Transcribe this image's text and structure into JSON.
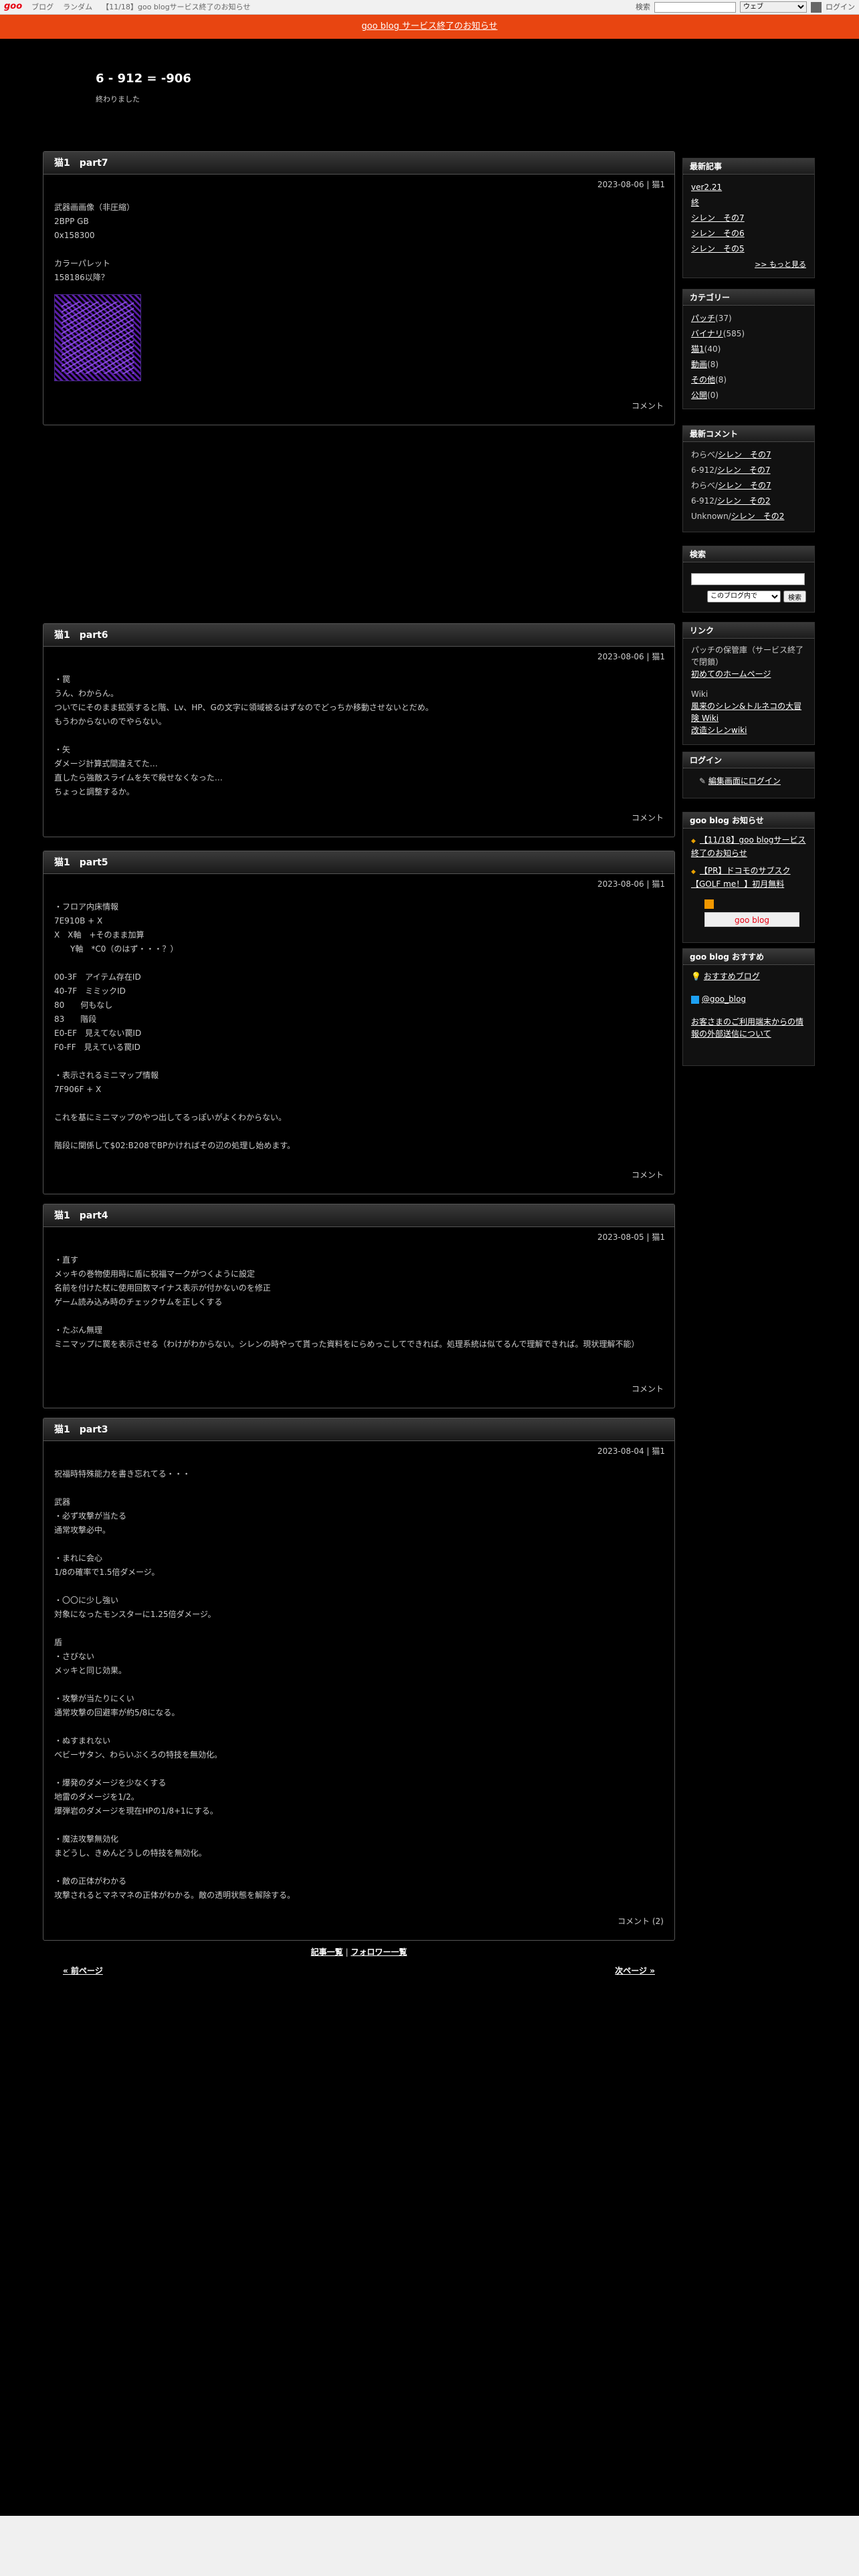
{
  "goo_bar": {
    "logo": "goo",
    "links": [
      "ブログ",
      "ランダム",
      "【11/18】goo blogサービス終了のお知らせ"
    ],
    "search_label": "検索",
    "search_select": "ウェブ",
    "login": "ログイン"
  },
  "notice": "goo blog サービス終了のお知らせ",
  "blog": {
    "title": "6 - 912 = -906",
    "description": "終わりました"
  },
  "entries": [
    {
      "title": "猫1　part7",
      "date": "2023-08-06 | 猫1",
      "lines": [
        "武器画画像（非圧縮）",
        "2BPP GB",
        "0x158300",
        "",
        "カラーパレット",
        "158186以降？"
      ],
      "comment": "コメント"
    },
    {
      "title": "猫1　part6",
      "date": "2023-08-06 | 猫1",
      "lines": [
        "・罠",
        "うん、わからん。",
        "ついでにそのまま拡張すると階、Lv、HP、Gの文字に領域被るはずなのでどっちか移動させないとだめ。",
        "もうわからないのでやらない。",
        "",
        "・矢",
        "ダメージ計算式間違えてた…",
        "直したら強敵スライムを矢で殺せなくなった…",
        "ちょっと調整するか。"
      ],
      "comment": "コメント"
    },
    {
      "title": "猫1　part5",
      "date": "2023-08-06 | 猫1",
      "lines": [
        "・フロア内床情報",
        "7E910B + X",
        "X　X軸　+そのまま加算",
        "　　Y軸　*C0（のはず・・・？）",
        "",
        "00-3F　アイテム存在ID",
        "40-7F　ミミックID",
        "80　　何もなし",
        "83　　階段",
        "E0-EF　見えてない罠ID",
        "F0-FF　見えている罠ID",
        "",
        "・表示されるミニマップ情報",
        "7F906F + X",
        "",
        "これを基にミニマップのやつ出してるっぽいがよくわからない。",
        "",
        "階段に関係して$02:B208でBPかければその辺の処理し始めます。"
      ],
      "comment": "コメント"
    },
    {
      "title": "猫1　part4",
      "date": "2023-08-05 | 猫1",
      "lines": [
        "・直す",
        "メッキの巻物使用時に盾に祝福マークがつくように設定",
        "名前を付けた杖に使用回数マイナス表示が付かないのを修正",
        "ゲーム読み込み時のチェックサムを正しくする",
        "",
        "・たぶん無理",
        "ミニマップに罠を表示させる（わけがわからない。シレンの時やって貰った資料をにらめっこしてできれば。処理系統は似てるんで理解できれば。現状理解不能）"
      ],
      "comment": "コメント"
    },
    {
      "title": "猫1　part3",
      "date": "2023-08-04 | 猫1",
      "lines": [
        "祝福時特殊能力を書き忘れてる・・・",
        "",
        "武器",
        "・必ず攻撃が当たる",
        "通常攻撃必中。",
        "",
        "・まれに会心",
        "1/8の確率で1.5倍ダメージ。",
        "",
        "・〇〇に少し強い",
        "対象になったモンスターに1.25倍ダメージ。",
        "",
        "盾",
        "・さびない",
        "メッキと同じ効果。",
        "",
        "・攻撃が当たりにくい",
        "通常攻撃の回避率が約5/8になる。",
        "",
        "・ぬすまれない",
        "ベビーサタン、わらいぶくろの特技を無効化。",
        "",
        "・爆発のダメージを少なくする",
        "地雷のダメージを1/2。",
        "爆弾岩のダメージを現在HPの1/8+1にする。",
        "",
        "・魔法攻撃無効化",
        "まどうし、きめんどうしの特技を無効化。",
        "",
        "・敵の正体がわかる",
        "攻撃されるとマネマネの正体がわかる。敵の透明状態を解除する。"
      ],
      "comment": "コメント (2)"
    }
  ],
  "sidebar": {
    "recent_entries": {
      "title": "最新記事",
      "items": [
        "ver2.21",
        "終",
        "シレン　その7",
        "シレン　その6",
        "シレン　その5"
      ],
      "more": ">> もっと見る"
    },
    "categories": {
      "title": "カテゴリー",
      "items": [
        {
          "name": "パッチ",
          "count": "(37)"
        },
        {
          "name": "バイナリ",
          "count": "(585)"
        },
        {
          "name": "猫1",
          "count": "(40)"
        },
        {
          "name": "動画",
          "count": "(8)"
        },
        {
          "name": "その他",
          "count": "(8)"
        },
        {
          "name": "公開",
          "count": "(0)"
        }
      ]
    },
    "recent_comments": {
      "title": "最新コメント",
      "items": [
        {
          "who": "わらべ/",
          "entry": "シレン　その7"
        },
        {
          "who": "6-912/",
          "entry": "シレン　その7"
        },
        {
          "who": "わらべ/",
          "entry": "シレン　その7"
        },
        {
          "who": "6-912/",
          "entry": "シレン　その2"
        },
        {
          "who": "Unknown/",
          "entry": "シレン　その2"
        }
      ]
    },
    "search": {
      "title": "検索",
      "select": "このブログ内で",
      "button": "検索"
    },
    "links": {
      "title": "リンク",
      "text1": "パッチの保管庫（サービス終了で閉鎖）",
      "link1": "初めてのホームページ",
      "text2": "Wiki",
      "link2": "風来のシレン&トルネコの大冒険 Wiki",
      "link3": "改造シレンwiki"
    },
    "login": {
      "title": "ログイン",
      "link": "編集画面にログイン"
    },
    "goo_notice": {
      "title": "goo blog お知らせ",
      "items": [
        "【11/18】goo blogサービス終了のお知らせ",
        "【PR】ドコモのサブスク【GOLF me！】初月無料"
      ],
      "button": "goo blog"
    },
    "goo_recommend": {
      "title": "goo blog おすすめ",
      "item1": "おすすめブログ",
      "item2": "@goo_blog",
      "item3": "お客さまのご利用端末からの情報の外部送信について"
    }
  },
  "pager": {
    "list": "記事一覧",
    "sep": " | ",
    "follower": "フォロワー一覧",
    "prev": "« 前ページ",
    "next": "次ページ »"
  }
}
